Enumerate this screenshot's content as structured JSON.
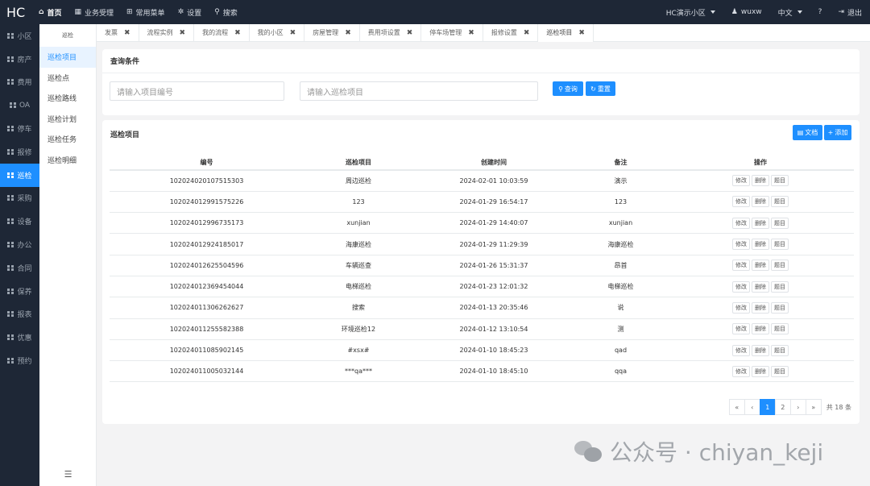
{
  "app": {
    "logo": "HC"
  },
  "topnav": [
    {
      "label": "首页",
      "icon": "home-icon"
    },
    {
      "label": "业务受理",
      "icon": "calendar-icon"
    },
    {
      "label": "常用菜单",
      "icon": "sitemap-icon"
    },
    {
      "label": "设置",
      "icon": "gear-icon"
    },
    {
      "label": "搜索",
      "icon": "search-icon"
    }
  ],
  "topright": {
    "community": "HC演示小区",
    "user": "wuxw",
    "language": "中文",
    "help": "?",
    "logout": "退出"
  },
  "sidebar": [
    {
      "label": "小区"
    },
    {
      "label": "房产"
    },
    {
      "label": "费用"
    },
    {
      "label": "OA"
    },
    {
      "label": "停车"
    },
    {
      "label": "报修"
    },
    {
      "label": "巡检"
    },
    {
      "label": "采购"
    },
    {
      "label": "设备"
    },
    {
      "label": "办公"
    },
    {
      "label": "合同"
    },
    {
      "label": "保养"
    },
    {
      "label": "报表"
    },
    {
      "label": "优惠"
    },
    {
      "label": "预约"
    }
  ],
  "subsidebar": {
    "title": "巡检",
    "items": [
      {
        "label": "巡检项目"
      },
      {
        "label": "巡检点"
      },
      {
        "label": "巡检路线"
      },
      {
        "label": "巡检计划"
      },
      {
        "label": "巡检任务"
      },
      {
        "label": "巡检明细"
      }
    ],
    "toggle": "☰"
  },
  "tabs": [
    {
      "label": "发票"
    },
    {
      "label": "流程实例"
    },
    {
      "label": "我的流程"
    },
    {
      "label": "我的小区"
    },
    {
      "label": "房屋管理"
    },
    {
      "label": "费用项设置"
    },
    {
      "label": "停车场管理"
    },
    {
      "label": "报修设置"
    },
    {
      "label": "巡检项目"
    }
  ],
  "query": {
    "title": "查询条件",
    "item_code_placeholder": "请输入项目编号",
    "item_name_placeholder": "请输入巡检项目",
    "search_label": "查询",
    "reset_label": "重置"
  },
  "list": {
    "title": "巡检项目",
    "doc_label": "文档",
    "add_label": "添加",
    "columns": [
      "编号",
      "巡检项目",
      "创建时间",
      "备注",
      "操作"
    ],
    "actions": [
      "修改",
      "删除",
      "题目"
    ],
    "rows": [
      [
        "102024020107515303",
        "周边巡检",
        "2024-02-01 10:03:59",
        "演示"
      ],
      [
        "102024012991575226",
        "123",
        "2024-01-29 16:54:17",
        "123"
      ],
      [
        "102024012996735173",
        "xunjian",
        "2024-01-29 14:40:07",
        "xunjian"
      ],
      [
        "102024012924185017",
        "海康巡检",
        "2024-01-29 11:29:39",
        "海康巡检"
      ],
      [
        "102024012625504596",
        "车辆巡查",
        "2024-01-26 15:31:37",
        "昂首"
      ],
      [
        "102024012369454044",
        "电梯巡检",
        "2024-01-23 12:01:32",
        "电梯巡检"
      ],
      [
        "102024011306262627",
        "搜索",
        "2024-01-13 20:35:46",
        "说"
      ],
      [
        "102024011255582388",
        "环境巡检12",
        "2024-01-12 13:10:54",
        "测"
      ],
      [
        "102024011085902145",
        "#xsx#",
        "2024-01-10 18:45:23",
        "qad"
      ],
      [
        "102024011005032144",
        "***qa***",
        "2024-01-10 18:45:10",
        "qqa"
      ]
    ]
  },
  "pager": {
    "first": "«",
    "prev": "‹",
    "pages": [
      "1",
      "2"
    ],
    "current": "1",
    "next": "›",
    "last": "»",
    "total": "共 18 条"
  },
  "watermark": {
    "text": "公众号 · chiyan_keji"
  }
}
